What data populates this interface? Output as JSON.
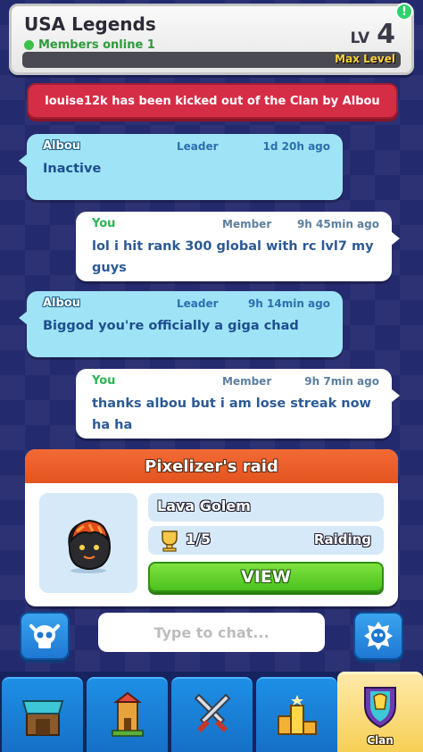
{
  "header": {
    "clan_name": "USA Legends",
    "online_text": "Members online 1",
    "level_label": "LV",
    "level_value": "4",
    "max_level_label": "Max Level",
    "info_icon": "!"
  },
  "system_message": "louise12k has been kicked out of the Clan by Albou",
  "messages": [
    {
      "name": "Albou",
      "role": "Leader",
      "time": "1d 20h ago",
      "text": "Inactive",
      "mine": false
    },
    {
      "name": "You",
      "role": "Member",
      "time": "9h 45min ago",
      "text": "lol i hit rank 300 global with rc lvl7 my guys",
      "mine": true
    },
    {
      "name": "Albou",
      "role": "Leader",
      "time": "9h 14min ago",
      "text": "Biggod you're officially a giga chad",
      "mine": false
    },
    {
      "name": "You",
      "role": "Member",
      "time": "9h 7min ago",
      "text": "thanks albou but i am lose streak now ha ha",
      "mine": true
    }
  ],
  "raid": {
    "title": "Pixelizer's raid",
    "boss_name": "Lava Golem",
    "progress": "1/5",
    "status": "Raiding",
    "view_label": "VIEW"
  },
  "chat_input": {
    "placeholder": "Type to chat..."
  },
  "nav": {
    "items": [
      {
        "icon": "shop-icon",
        "label": ""
      },
      {
        "icon": "castle-icon",
        "label": ""
      },
      {
        "icon": "battle-swords-icon",
        "label": ""
      },
      {
        "icon": "leaderboard-icon",
        "label": ""
      },
      {
        "icon": "clan-shield-icon",
        "label": "Clan"
      }
    ]
  },
  "colors": {
    "background": "#242a6e",
    "system_red": "#d62d47",
    "other_bubble": "#9fe3f6",
    "raid_orange": "#e4541f",
    "view_green": "#4bc21d",
    "nav_blue": "#1570c6",
    "nav_active": "#f6cf55"
  }
}
